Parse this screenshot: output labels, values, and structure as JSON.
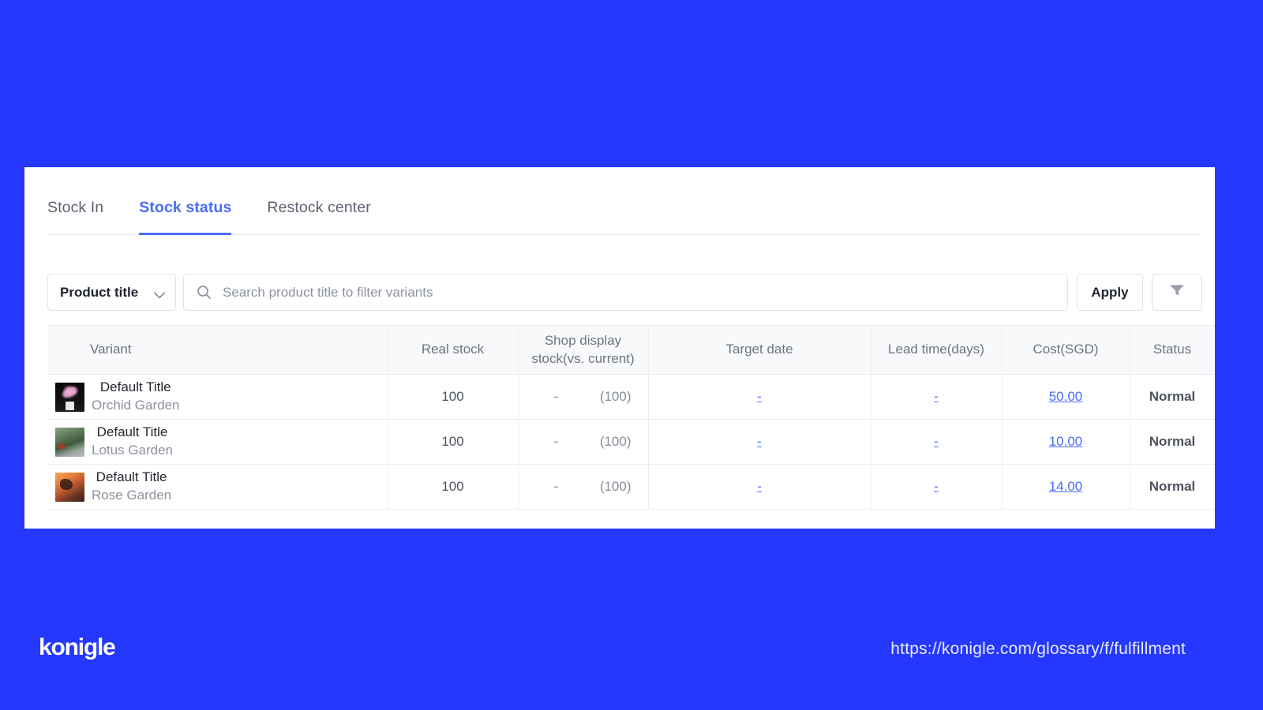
{
  "colors": {
    "background": "#2638fd",
    "panel": "#ffffff",
    "accent": "#4a6cf7",
    "status_normal_bg": "#d9f7e0",
    "status_normal_text": "#1d6b37",
    "link": "#4a6cf7"
  },
  "tabs": [
    {
      "label": "Stock In",
      "active": false
    },
    {
      "label": "Stock status",
      "active": true
    },
    {
      "label": "Restock center",
      "active": false
    }
  ],
  "filters": {
    "select_label": "Product title",
    "select_icon": "chevron-down-icon",
    "search_icon": "search-icon",
    "search_value": "",
    "search_placeholder": "Search product title to filter variants",
    "apply_label": "Apply",
    "filter_icon": "funnel-icon"
  },
  "table": {
    "headers": [
      "Variant",
      "Real stock",
      "Shop display stock(vs. current)",
      "Target date",
      "Lead time(days)",
      "Cost(SGD)",
      "Status"
    ],
    "header_shop_line1": "Shop display",
    "header_shop_line2": "stock(vs. current)",
    "rows": [
      {
        "thumb": "orchid",
        "variant_title": "Default Title",
        "product_name": "Orchid Garden",
        "real_stock": "100",
        "shop_display_dash": "-",
        "shop_display_current": "(100)",
        "target_date": "-",
        "lead_time": "-",
        "cost": "50.00",
        "status": "Normal"
      },
      {
        "thumb": "lotus",
        "variant_title": "Default Title",
        "product_name": "Lotus Garden",
        "real_stock": "100",
        "shop_display_dash": "-",
        "shop_display_current": "(100)",
        "target_date": "-",
        "lead_time": "-",
        "cost": "10.00",
        "status": "Normal"
      },
      {
        "thumb": "rose",
        "variant_title": "Default Title",
        "product_name": "Rose Garden",
        "real_stock": "100",
        "shop_display_dash": "-",
        "shop_display_current": "(100)",
        "target_date": "-",
        "lead_time": "-",
        "cost": "14.00",
        "status": "Normal"
      }
    ]
  },
  "footer": {
    "logo_text": "konigle",
    "url": "https://konigle.com/glossary/f/fulfillment"
  }
}
